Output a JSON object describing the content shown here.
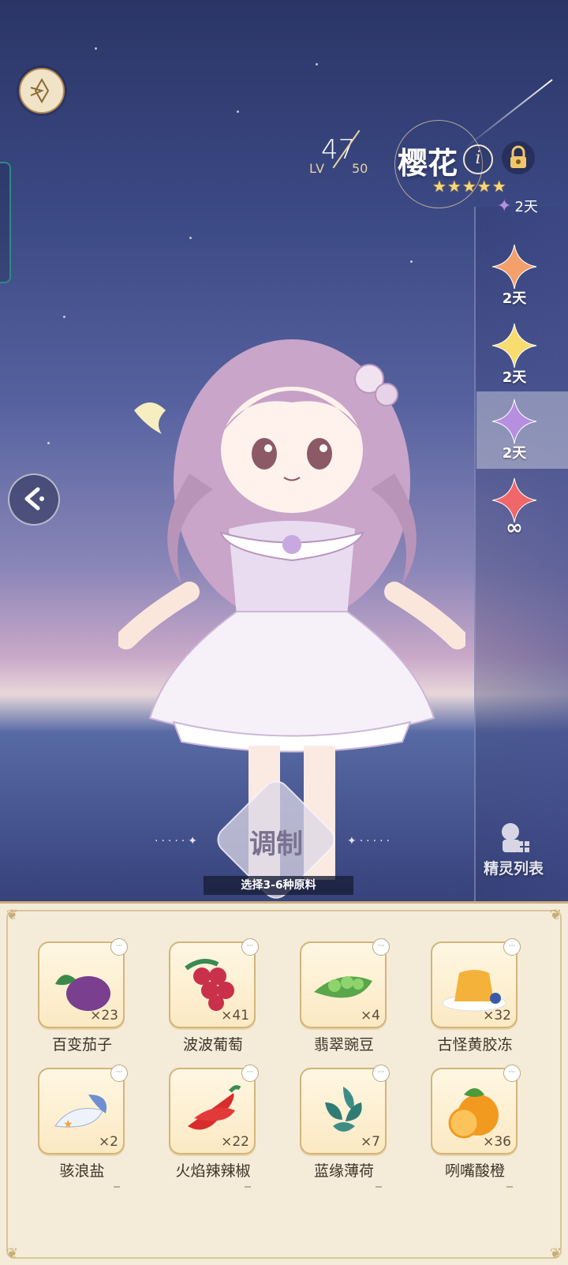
{
  "header": {
    "lv_label": "LV",
    "level": "47",
    "level_max": "50",
    "name": "樱花",
    "info_glyph": "i",
    "stars": "★★★★★"
  },
  "right_panel": {
    "top_timer": "2天",
    "slots": [
      {
        "label": "2天",
        "color": "#f4a06a"
      },
      {
        "label": "2天",
        "color": "#f9dc6f"
      },
      {
        "label": "2天",
        "color": "#b78fe0"
      },
      {
        "label": "∞",
        "color": "#f0676a"
      }
    ],
    "sprite_list_label": "精灵列表"
  },
  "craft": {
    "button_label": "调制",
    "hint": "选择3-6种原料"
  },
  "ingredients": [
    {
      "name": "百变茄子",
      "count": "×23",
      "icon": "eggplant-icon"
    },
    {
      "name": "波波葡萄",
      "count": "×41",
      "icon": "grapes-icon"
    },
    {
      "name": "翡翠豌豆",
      "count": "×4",
      "icon": "peas-icon"
    },
    {
      "name": "古怪黄胶冻",
      "count": "×32",
      "icon": "jelly-icon"
    },
    {
      "name": "骇浪盐",
      "count": "×2",
      "icon": "salt-icon"
    },
    {
      "name": "火焰辣辣椒",
      "count": "×22",
      "icon": "chili-icon"
    },
    {
      "name": "蓝缘薄荷",
      "count": "×7",
      "icon": "mint-icon"
    },
    {
      "name": "咧嘴酸橙",
      "count": "×36",
      "icon": "orange-icon"
    }
  ],
  "colors": {
    "accent_gold": "#c9ad76",
    "panel_bg": "#f4ecd9",
    "active_slot": "#b78fe0"
  }
}
